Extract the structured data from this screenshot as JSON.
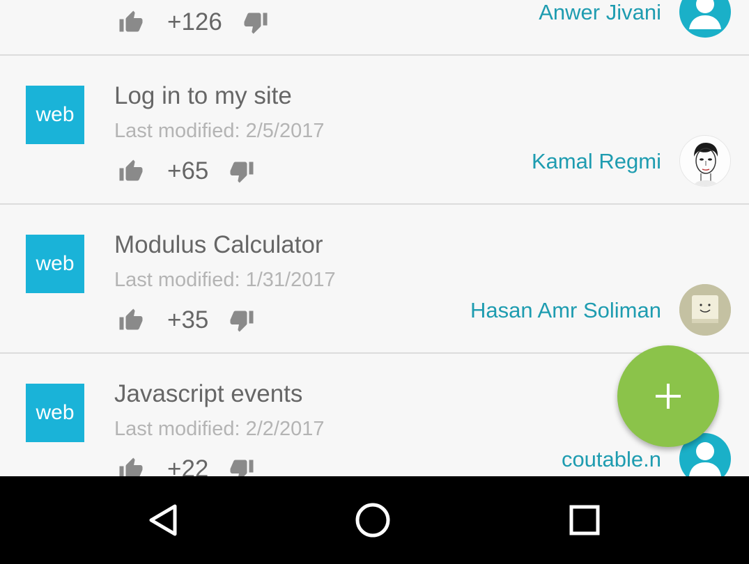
{
  "colors": {
    "accent": "#1ab3d8",
    "author": "#1e9cb0",
    "fab": "#8bc34a",
    "thumb": "#8a8a8a",
    "avatar_default": "#1ab0c8"
  },
  "top_partial": {
    "score": "+126",
    "author": "Anwer Jivani",
    "avatar": "default-user-icon"
  },
  "items": [
    {
      "badge": "web",
      "title": "Log in to my site",
      "modified": "Last modified: 2/5/2017",
      "score": "+65",
      "author": "Kamal Regmi",
      "avatar": "sketch-face-photo"
    },
    {
      "badge": "web",
      "title": "Modulus Calculator",
      "modified": "Last modified: 1/31/2017",
      "score": "+35",
      "author": "Hasan Amr Soliman",
      "avatar": "smiley-box-photo"
    },
    {
      "badge": "web",
      "title": "Javascript events",
      "modified": "Last modified: 2/2/2017",
      "score": "+22",
      "author": "coutable.n",
      "avatar": "default-user-icon"
    }
  ],
  "fab": {
    "icon": "plus-icon"
  },
  "navbar": {
    "back": "back-icon",
    "home": "home-icon",
    "recents": "recents-icon"
  }
}
